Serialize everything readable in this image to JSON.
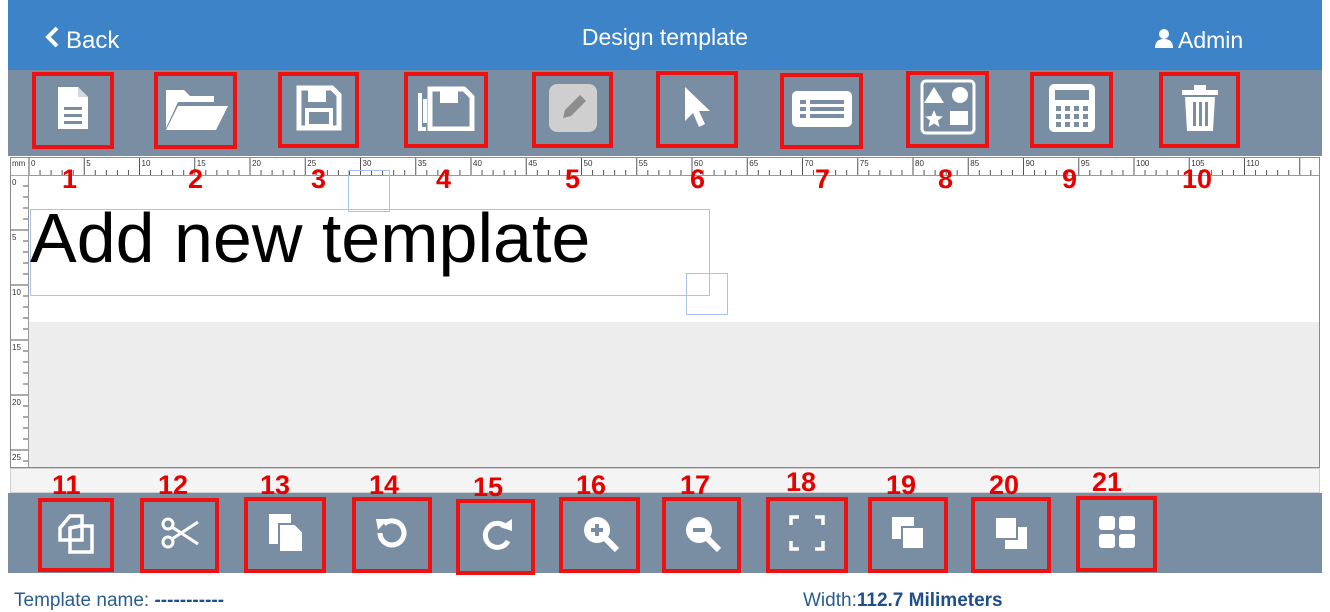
{
  "header": {
    "back_label": "Back",
    "title": "Design template",
    "user_label": "Admin"
  },
  "toolbar_top": [
    {
      "number": "1",
      "icon": "new-document-icon"
    },
    {
      "number": "2",
      "icon": "open-folder-icon"
    },
    {
      "number": "3",
      "icon": "save-icon"
    },
    {
      "number": "4",
      "icon": "save-as-icon"
    },
    {
      "number": "5",
      "icon": "edit-pencil-icon"
    },
    {
      "number": "6",
      "icon": "select-pointer-icon"
    },
    {
      "number": "7",
      "icon": "list-properties-icon"
    },
    {
      "number": "8",
      "icon": "shapes-icon"
    },
    {
      "number": "9",
      "icon": "calculator-icon"
    },
    {
      "number": "10",
      "icon": "trash-icon"
    }
  ],
  "toolbar_bottom": [
    {
      "number": "11",
      "icon": "copy-icon"
    },
    {
      "number": "12",
      "icon": "cut-icon"
    },
    {
      "number": "13",
      "icon": "paste-icon"
    },
    {
      "number": "14",
      "icon": "undo-icon"
    },
    {
      "number": "15",
      "icon": "redo-icon"
    },
    {
      "number": "16",
      "icon": "zoom-in-icon"
    },
    {
      "number": "17",
      "icon": "zoom-out-icon"
    },
    {
      "number": "18",
      "icon": "fit-screen-icon"
    },
    {
      "number": "19",
      "icon": "bring-to-front-icon"
    },
    {
      "number": "20",
      "icon": "send-to-back-icon"
    },
    {
      "number": "21",
      "icon": "grid-icon"
    }
  ],
  "ruler": {
    "unit": "mm",
    "h_labels": [
      "0",
      "5",
      "10",
      "15",
      "20",
      "25",
      "30",
      "35",
      "40",
      "45",
      "50",
      "55",
      "60",
      "65",
      "70",
      "75",
      "80",
      "85",
      "90",
      "95",
      "100",
      "105",
      "110"
    ],
    "v_labels": [
      "0",
      "5",
      "10",
      "15",
      "20",
      "25"
    ]
  },
  "canvas": {
    "text": "Add new template"
  },
  "footer": {
    "template_name_label": "Template name:",
    "template_name_value": "-----------",
    "width_label": "Width:",
    "width_value": "112.7 Milimeters"
  },
  "colors": {
    "header_bg": "#3d83c7",
    "toolbar_bg": "#7a8ea3",
    "highlight": "#ee1111",
    "number_color": "#e60000"
  }
}
